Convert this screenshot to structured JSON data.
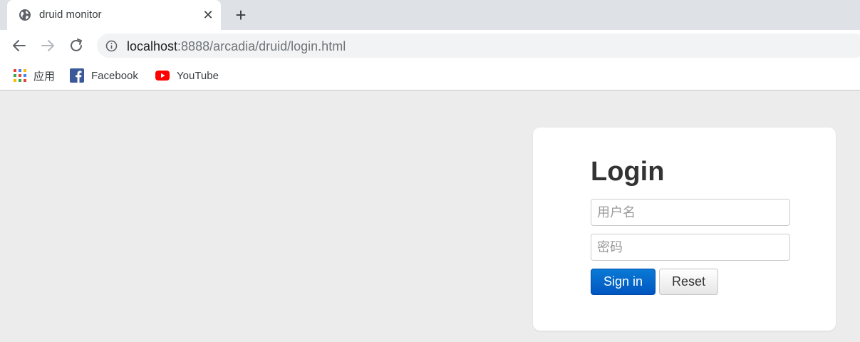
{
  "browser": {
    "tab": {
      "title": "druid monitor",
      "favicon": "globe-icon",
      "close_glyph": "✕"
    },
    "newtab_glyph": "+",
    "omnibox": {
      "url_host": "localhost",
      "url_rest": ":8888/arcadia/druid/login.html"
    },
    "bookmarks": [
      {
        "label": "应用",
        "icon": "apps-grid-icon"
      },
      {
        "label": "Facebook",
        "icon": "facebook-icon"
      },
      {
        "label": "YouTube",
        "icon": "youtube-icon"
      }
    ]
  },
  "login": {
    "title": "Login",
    "username_placeholder": "用户名",
    "username_value": "",
    "password_placeholder": "密码",
    "password_value": "",
    "signin_label": "Sign in",
    "reset_label": "Reset"
  },
  "colors": {
    "page_bg": "#ececec",
    "primary_button": "#0062cc",
    "youtube_red": "#ff0000",
    "facebook_blue": "#3b5998"
  }
}
